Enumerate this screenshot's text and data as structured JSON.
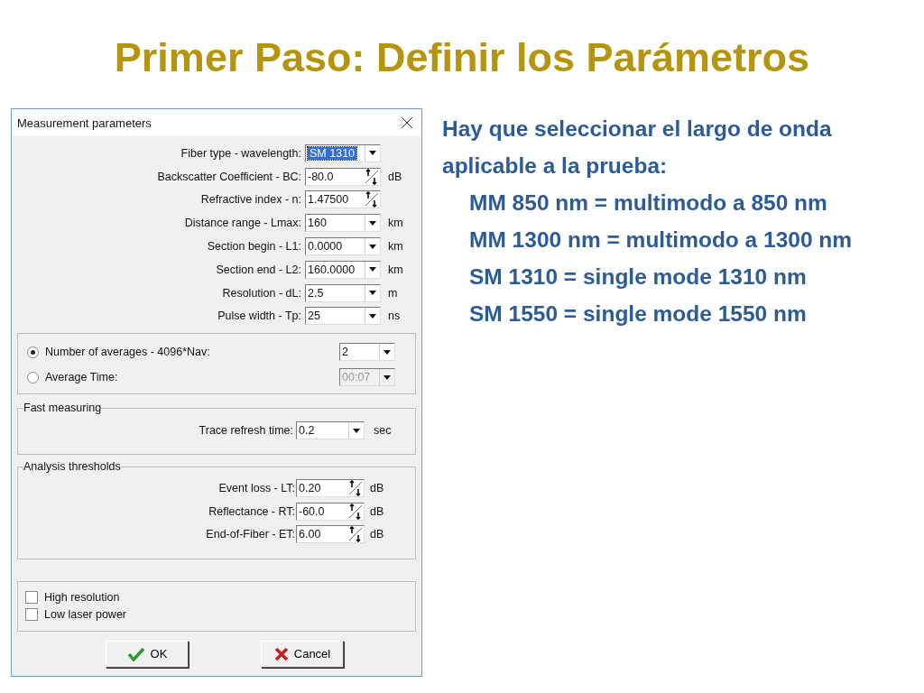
{
  "slide": {
    "title": "Primer Paso: Definir los Parámetros"
  },
  "dialog": {
    "title": "Measurement parameters",
    "parameters": [
      {
        "label": "Fiber type - wavelength:",
        "kind": "dropdown",
        "value": "SM 1310",
        "highlighted": true
      },
      {
        "label": "Backscatter Coefficient - BC:",
        "kind": "spin",
        "value": "-80.0",
        "unit": "dB",
        "highlighted": false
      },
      {
        "label": "Refractive index - n:",
        "kind": "spin",
        "value": "1.47500",
        "highlighted": false
      },
      {
        "label": "Distance range - Lmax:",
        "kind": "dropdown",
        "value": "160",
        "unit": "km",
        "highlighted": false
      },
      {
        "label": "Section begin - L1:",
        "kind": "dropdown",
        "value": "0.0000",
        "unit": "km",
        "highlighted": false
      },
      {
        "label": "Section end - L2:",
        "kind": "dropdown",
        "value": "160.0000",
        "unit": "km",
        "highlighted": false
      },
      {
        "label": "Resolution - dL:",
        "kind": "dropdown",
        "value": "2.5",
        "unit": "m",
        "highlighted": false
      },
      {
        "label": "Pulse width - Tp:",
        "kind": "dropdown",
        "value": "25",
        "unit": "ns",
        "highlighted": false
      }
    ],
    "averaging": [
      {
        "label": "Number of averages - 4096*Nav:",
        "selected": true,
        "value": "2",
        "disabled": false
      },
      {
        "label": "Average Time:",
        "selected": false,
        "value": "00:07",
        "disabled": true
      }
    ],
    "fast_measuring": {
      "title": "Fast measuring",
      "label": "Trace refresh time:",
      "value": "0.2",
      "unit": "sec"
    },
    "analysis": {
      "title": "Analysis thresholds",
      "rows": [
        {
          "label": "Event loss - LT:",
          "value": "0.20",
          "unit": "dB"
        },
        {
          "label": "Reflectance - RT:",
          "value": "-60.0",
          "unit": "dB"
        },
        {
          "label": "End-of-Fiber - ET:",
          "value": "6.00",
          "unit": "dB"
        }
      ]
    },
    "options": [
      {
        "label": "High resolution",
        "checked": false
      },
      {
        "label": "Low laser power",
        "checked": false
      }
    ],
    "buttons": [
      {
        "label": "OK",
        "kind": "ok"
      },
      {
        "label": "Cancel",
        "kind": "cancel"
      }
    ]
  },
  "notes": {
    "intro": "Hay que seleccionar el largo de onda aplicable a la prueba:",
    "items": [
      "MM 850 nm = multimodo a 850 nm",
      "MM 1300 nm = multimodo a 1300 nm",
      "SM 1310 = single mode 1310 nm",
      "SM 1550 = single mode 1550 nm"
    ]
  }
}
